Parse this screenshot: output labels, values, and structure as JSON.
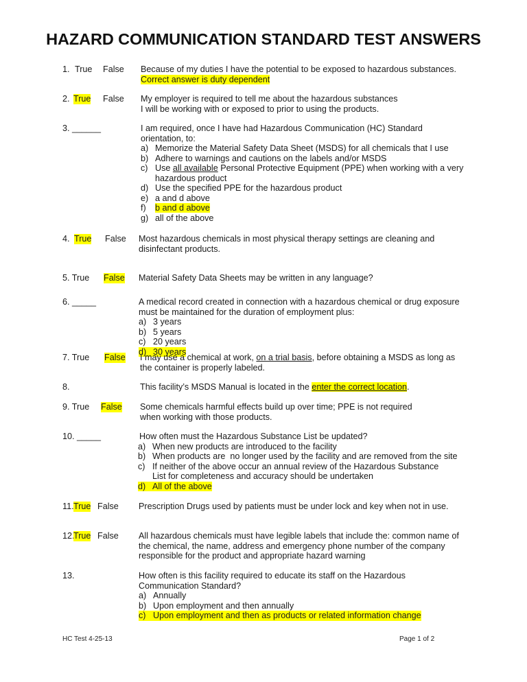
{
  "title": "HAZARD COMMUNICATION STANDARD TEST ANSWERS",
  "highlight_color": "#ffff00",
  "questions": [
    {
      "number": "1.",
      "true_label": "True",
      "false_label": "False",
      "answer": "duty dependent",
      "text": "Because of my duties I have the potential to be exposed to hazardous substances.",
      "note": "Correct answer is duty dependent"
    },
    {
      "number": "2.",
      "true_label": "True",
      "false_label": "False",
      "answer": "True",
      "line1": "My employer is required to tell me about the hazardous substances",
      "line2": "I will be working with or exposed to prior to using the products."
    },
    {
      "number": "3. ______",
      "answer": "f",
      "text": "I am required, once I have had Hazardous Communication (HC) Standard orientation, to:",
      "options": [
        {
          "m": "a)",
          "t": "Memorize the Material Safety Data Sheet (MSDS) for all chemicals that I use"
        },
        {
          "m": "b)",
          "t": "Adhere to warnings and cautions on the labels and/or MSDS"
        },
        {
          "m": "c)",
          "pre": "Use ",
          "u": "all available",
          "t": " Personal Protective Equipment (PPE) when working with a very hazardous product"
        },
        {
          "m": "d)",
          "t": "Use the specified PPE for the hazardous product"
        },
        {
          "m": "e)",
          "t": "a and d above"
        },
        {
          "m": "f)",
          "t": "b and d above"
        },
        {
          "m": "g)",
          "t": "all of the above"
        }
      ]
    },
    {
      "number": "4.",
      "true_label": "True",
      "false_label": "False",
      "answer": "True",
      "text": "Most hazardous chemicals in most physical therapy settings are cleaning and disinfectant products."
    },
    {
      "number": "5. True",
      "false_label": "False",
      "answer": "False",
      "text": "Material Safety Data Sheets may be written in any language?"
    },
    {
      "number": "6. _____",
      "answer": "d",
      "text": "A medical record created in connection with a hazardous chemical or drug exposure must be maintained for the duration of employment plus:",
      "options": [
        {
          "m": "a)",
          "t": "3 years"
        },
        {
          "m": "b)",
          "t": "5 years"
        },
        {
          "m": "c)",
          "t": "20 years"
        },
        {
          "m": "d)",
          "t": "30 years"
        }
      ]
    },
    {
      "number": "7. True",
      "false_label": "False",
      "answer": "False",
      "pre": "I may use a chemical at work, ",
      "u": "on a trial basis",
      "post": ", before obtaining a MSDS as long as the container is properly labeled."
    },
    {
      "number": "8.",
      "pre": "This facility’s MSDS Manual is located in the ",
      "blank": "enter the correct location",
      "post": "."
    },
    {
      "number": "9. True",
      "false_label": "False",
      "answer": "False",
      "line1": "Some chemicals harmful effects build up over time; PPE is not required",
      "line2": "when working with those products."
    },
    {
      "number": "10. _____",
      "answer": "d",
      "text": "How often must the Hazardous Substance List be updated?",
      "options": [
        {
          "m": "a)",
          "t": "When new products are introduced to the facility"
        },
        {
          "m": "b)",
          "t": "When products are  no longer used by the facility and are removed from the site"
        },
        {
          "m": "c)",
          "t": "If neither of the above occur an annual review of the Hazardous Substance List for completeness and accuracy should be undertaken"
        },
        {
          "m": "d)",
          "t": "All of the above"
        }
      ]
    },
    {
      "number": "11.",
      "true_label": "True",
      "false_label": "False",
      "answer": "True",
      "text": "Prescription Drugs used by patients must be under lock and key when not in use."
    },
    {
      "number": "12.",
      "true_label": "True",
      "false_label": "False",
      "answer": "True",
      "text": "All hazardous chemicals must have legible labels that include the: common name of the chemical, the name, address and emergency phone number of the company responsible for the product and appropriate hazard warning"
    },
    {
      "number": "13.",
      "answer": "c",
      "text": "How often is this facility required to educate its staff on the Hazardous Communication Standard?",
      "options": [
        {
          "m": "a)",
          "t": "Annually"
        },
        {
          "m": "b)",
          "t": "Upon employment and then annually"
        },
        {
          "m": "c)",
          "t": "Upon employment and then as products or related information change"
        }
      ]
    }
  ],
  "footer": {
    "left": "HC Test  4-25-13",
    "right": "Page 1 of 2"
  }
}
